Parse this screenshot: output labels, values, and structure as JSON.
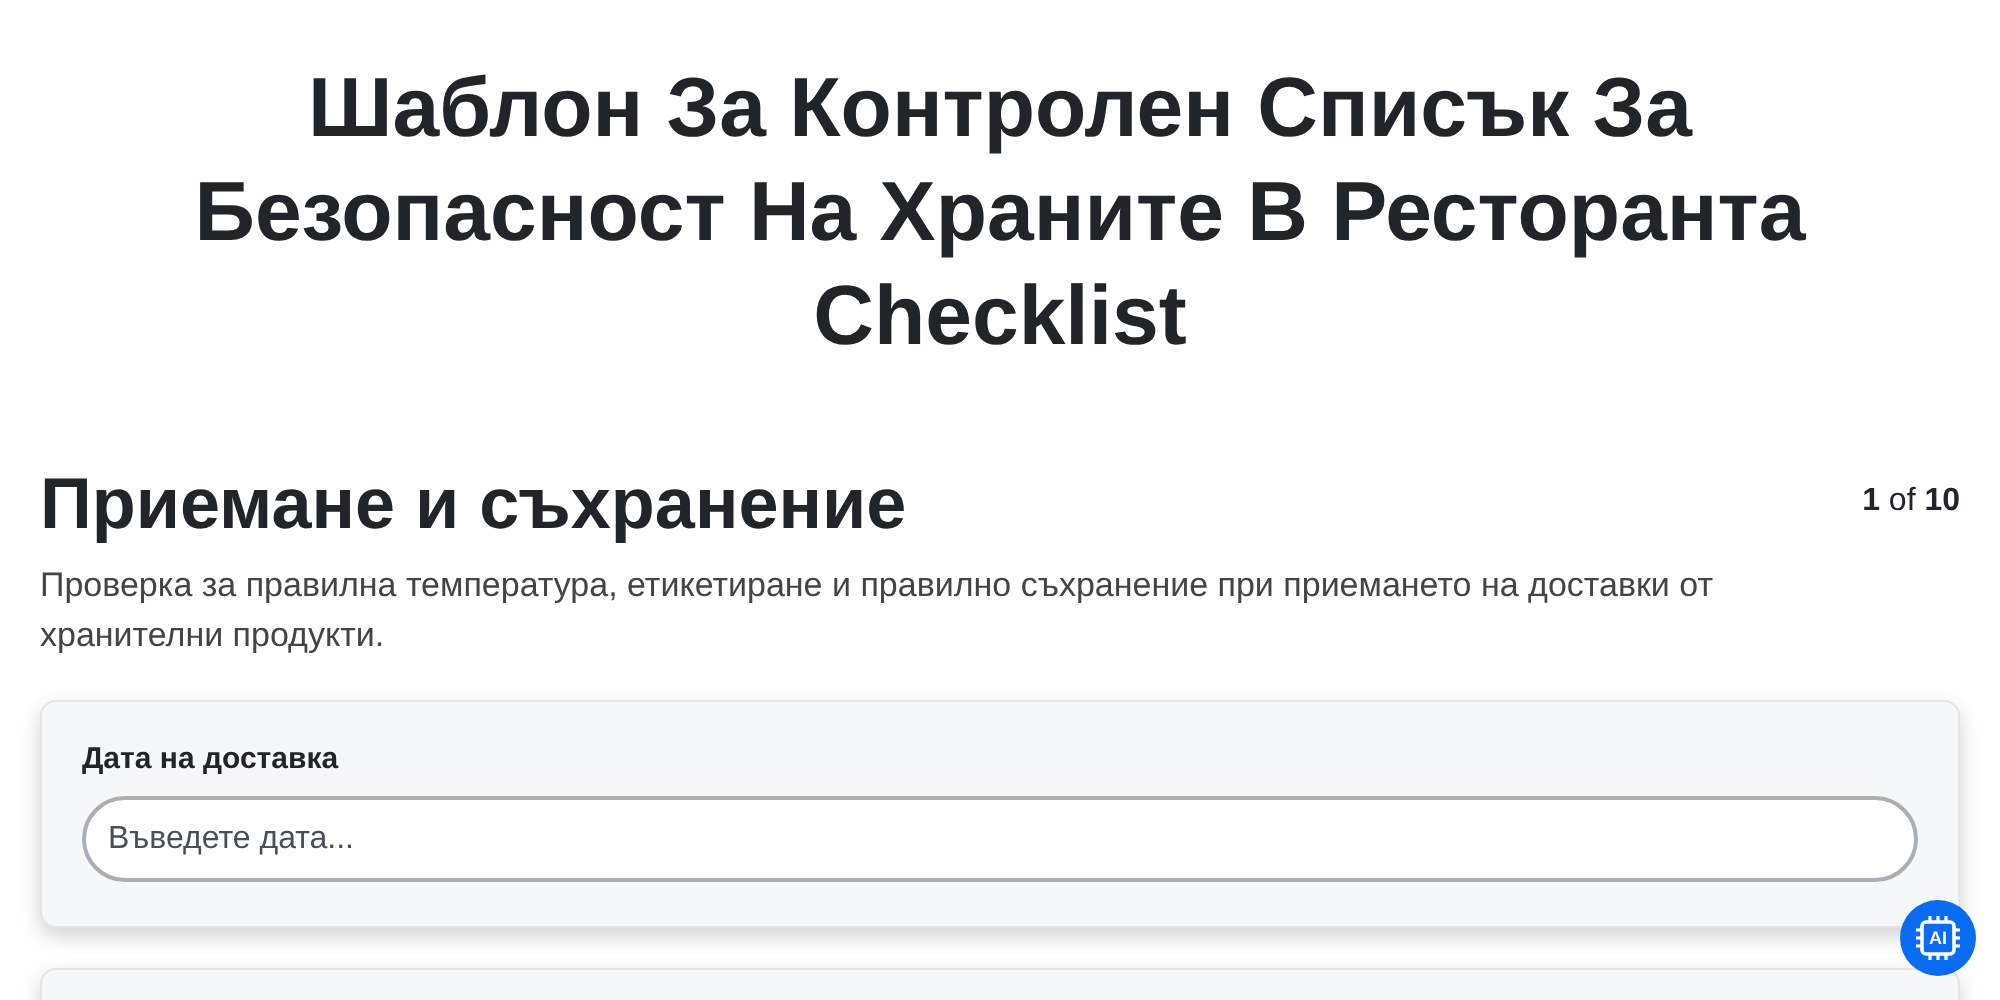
{
  "title": "Шаблон За Контролен Списък За Безопасност На Храните В Ресторанта Checklist",
  "section": {
    "heading": "Приемане и съхранение",
    "progress": "**1** of **10**",
    "description": "Проверка за правилна температура, етикетиране и правилно съхранение при приемането на доставки от хранителни продукти."
  },
  "fields": [
    {
      "kind": "text",
      "label": "Дата на доставка",
      "placeholder": "Въведете дата..."
    },
    {
      "kind": "blank"
    }
  ],
  "ai_button": {
    "label": "AI"
  }
}
